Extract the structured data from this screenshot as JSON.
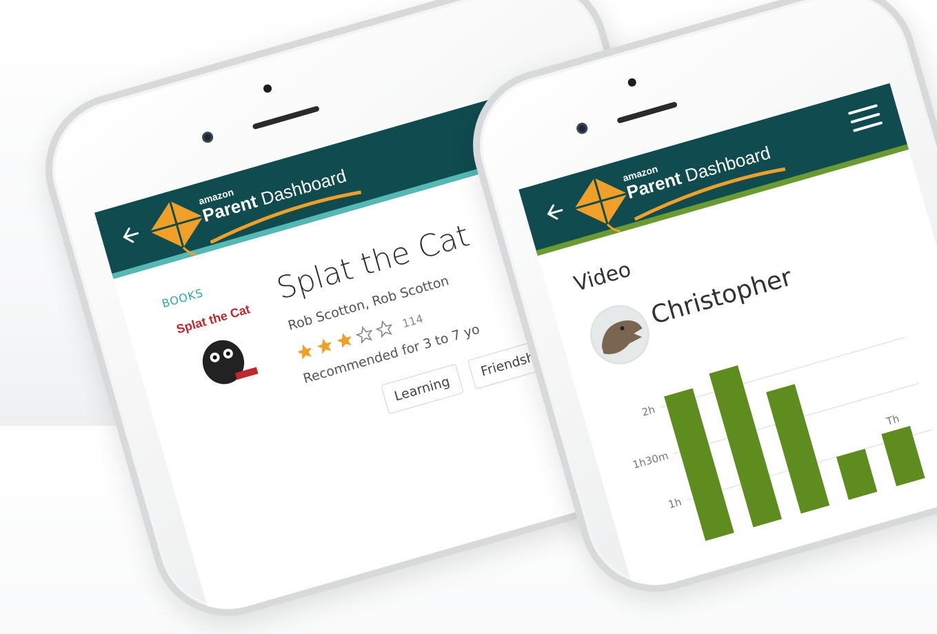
{
  "left_phone": {
    "brand": {
      "small": "amazon",
      "title_bold": "Parent",
      "title_rest": " Dashboard"
    },
    "section_label": "BOOKS",
    "book": {
      "title": "Splat the Cat",
      "authors": "Rob Scotton, Rob Scotton",
      "rating": 3,
      "rating_max": 5,
      "rating_count": "114",
      "recommended": "Recommended for 3 to 7 yo",
      "cover_text": "Splat the Cat"
    },
    "tags": [
      "Learning",
      "Friendship"
    ]
  },
  "right_phone": {
    "brand": {
      "small": "amazon",
      "title_bold": "Parent",
      "title_rest": " Dashboard"
    },
    "section_label": "Video",
    "child_name": "Christopher"
  },
  "colors": {
    "appbar": "#0f4b4f",
    "accent_teal": "#54b9b4",
    "accent_green": "#6b9b2f",
    "star": "#f0a028",
    "bar": "#5e8c1f"
  },
  "icons": [
    "back-arrow-icon",
    "hamburger-menu-icon",
    "kite-icon",
    "star-icon",
    "camera-icon"
  ],
  "chart_data": {
    "type": "bar",
    "categories": [
      "",
      "",
      "",
      "",
      "Th"
    ],
    "values": [
      2.1,
      2.2,
      1.85,
      1.0,
      1.1
    ],
    "y_ticks": [
      "2h",
      "1h30m",
      "1h"
    ],
    "ylim": [
      0.75,
      2.4
    ],
    "grid": true
  }
}
